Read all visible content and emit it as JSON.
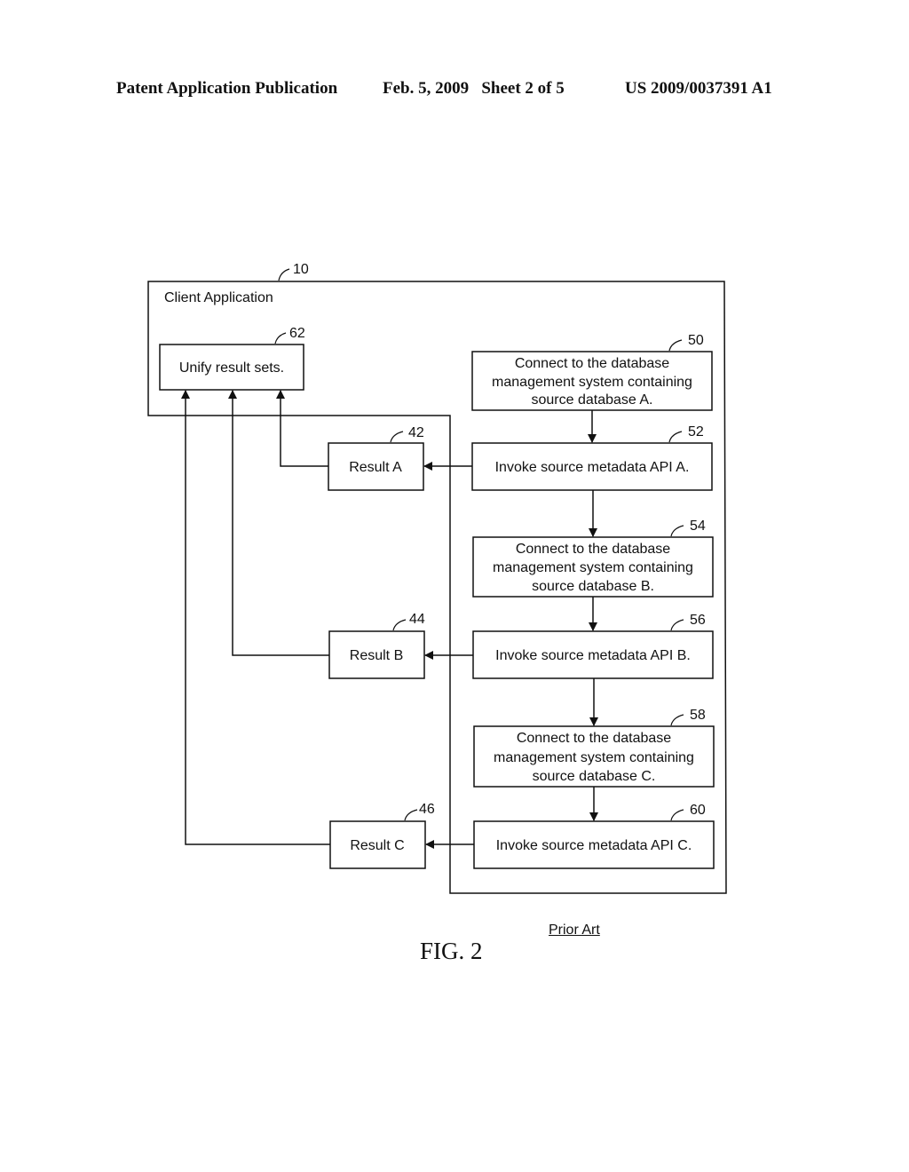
{
  "header": {
    "publication": "Patent Application Publication",
    "date_sheet": "Feb. 5, 2009   Sheet 2 of 5",
    "number": "US 2009/0037391 A1"
  },
  "diagram": {
    "container": {
      "ref": "10",
      "label": "Client Application"
    },
    "unify": {
      "ref": "62",
      "label": "Unify result sets."
    },
    "steps": [
      {
        "ref": "50",
        "lines": [
          "Connect to the database",
          "management system containing",
          "source database A."
        ]
      },
      {
        "ref": "52",
        "lines": [
          "Invoke source metadata API A."
        ]
      },
      {
        "ref": "54",
        "lines": [
          "Connect to the database",
          "management system containing",
          "source database B."
        ]
      },
      {
        "ref": "56",
        "lines": [
          "Invoke source metadata API B."
        ]
      },
      {
        "ref": "58",
        "lines": [
          "Connect to the database",
          "management system containing",
          "source database C."
        ]
      },
      {
        "ref": "60",
        "lines": [
          "Invoke source metadata API C."
        ]
      }
    ],
    "results": [
      {
        "ref": "42",
        "label": "Result A"
      },
      {
        "ref": "44",
        "label": "Result B"
      },
      {
        "ref": "46",
        "label": "Result C"
      }
    ]
  },
  "caption": {
    "figure": "FIG. 2",
    "note": "Prior Art"
  }
}
